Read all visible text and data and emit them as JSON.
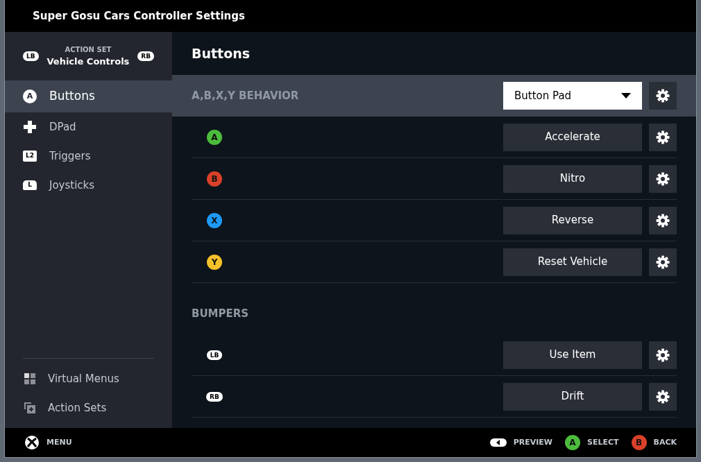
{
  "window": {
    "title": "Super Gosu Cars Controller Settings"
  },
  "action_set": {
    "label": "ACTION SET",
    "name": "Vehicle Controls",
    "prev": "LB",
    "next": "RB"
  },
  "sidebar": {
    "items": [
      {
        "label": "Buttons",
        "kind": "face",
        "glyph": "A",
        "selected": true
      },
      {
        "label": "DPad",
        "kind": "dpad",
        "selected": false
      },
      {
        "label": "Triggers",
        "kind": "trigger",
        "glyph": "L2",
        "selected": false
      },
      {
        "label": "Joysticks",
        "kind": "stick",
        "glyph": "L",
        "selected": false
      }
    ],
    "bottom_items": [
      {
        "label": "Virtual Menus",
        "kind": "grid"
      },
      {
        "label": "Action Sets",
        "kind": "sets"
      }
    ]
  },
  "content": {
    "title": "Buttons",
    "groups": [
      {
        "title": "A,B,X,Y BEHAVIOR",
        "highlighted": true,
        "dropdown": {
          "value": "Button Pad"
        },
        "rows": [
          {
            "kind": "face",
            "glyph": "A",
            "color": "#4cbc3c",
            "binding": "Accelerate"
          },
          {
            "kind": "face",
            "glyph": "B",
            "color": "#d9412a",
            "binding": "Nitro"
          },
          {
            "kind": "face",
            "glyph": "X",
            "color": "#1e9af5",
            "binding": "Reverse"
          },
          {
            "kind": "face",
            "glyph": "Y",
            "color": "#f5c12a",
            "binding": "Reset Vehicle"
          }
        ]
      },
      {
        "title": "BUMPERS",
        "highlighted": false,
        "rows": [
          {
            "kind": "bumper",
            "glyph": "LB",
            "binding": "Use Item"
          },
          {
            "kind": "bumper",
            "glyph": "RB",
            "binding": "Drift"
          }
        ]
      }
    ]
  },
  "footer": {
    "menu": "MENU",
    "hints": [
      {
        "kind": "preview",
        "label": "PREVIEW"
      },
      {
        "kind": "face",
        "glyph": "A",
        "color": "#4cbc3c",
        "label": "SELECT"
      },
      {
        "kind": "face",
        "glyph": "B",
        "color": "#d9412a",
        "label": "BACK"
      }
    ]
  }
}
